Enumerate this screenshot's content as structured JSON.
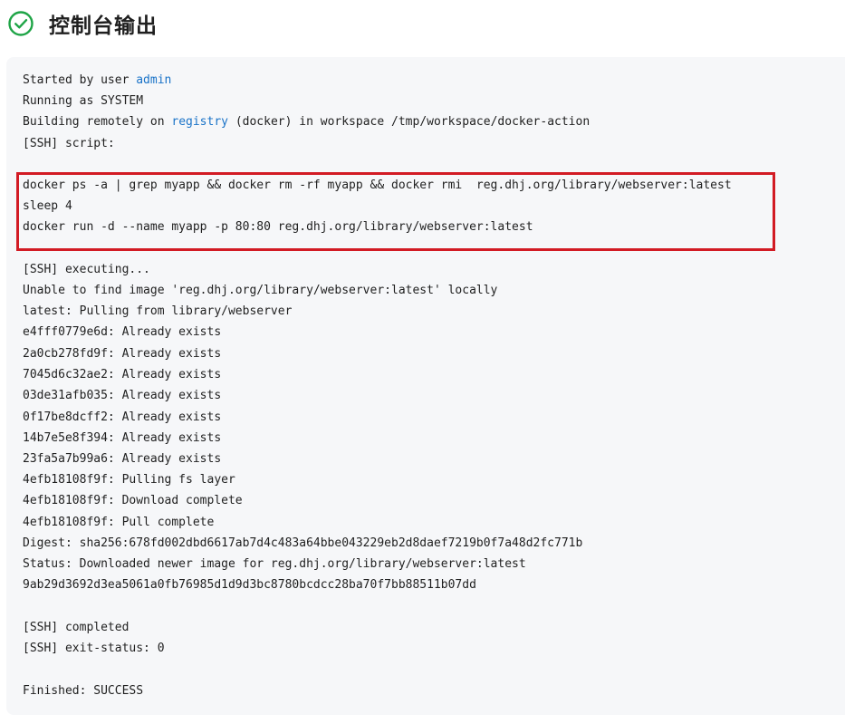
{
  "page": {
    "title": "控制台输出",
    "status_icon": "check-circle-icon",
    "status_color": "#1ea446"
  },
  "colors": {
    "console_background": "#f6f7f9",
    "link": "#1a73c8",
    "highlight_border": "#d21b24"
  },
  "console": {
    "line1": {
      "prefix": "Started by user ",
      "link": "admin"
    },
    "line2": "Running as SYSTEM",
    "line3": {
      "prefix": "Building remotely on ",
      "link": "registry",
      "suffix": " (docker) in workspace /tmp/workspace/docker-action"
    },
    "line4": "[SSH] script:",
    "script": [
      "docker ps -a | grep myapp && docker rm -rf myapp && docker rmi  reg.dhj.org/library/webserver:latest",
      "sleep 4",
      "docker run -d --name myapp -p 80:80 reg.dhj.org/library/webserver:latest"
    ],
    "output": [
      "[SSH] executing...",
      "Unable to find image 'reg.dhj.org/library/webserver:latest' locally",
      "latest: Pulling from library/webserver",
      "e4fff0779e6d: Already exists",
      "2a0cb278fd9f: Already exists",
      "7045d6c32ae2: Already exists",
      "03de31afb035: Already exists",
      "0f17be8dcff2: Already exists",
      "14b7e5e8f394: Already exists",
      "23fa5a7b99a6: Already exists",
      "4efb18108f9f: Pulling fs layer",
      "4efb18108f9f: Download complete",
      "4efb18108f9f: Pull complete",
      "Digest: sha256:678fd002dbd6617ab7d4c483a64bbe043229eb2d8daef7219b0f7a48d2fc771b",
      "Status: Downloaded newer image for reg.dhj.org/library/webserver:latest",
      "9ab29d3692d3ea5061a0fb76985d1d9d3bc8780bcdcc28ba70f7bb88511b07dd"
    ],
    "completed": "[SSH] completed",
    "exit_status": "[SSH] exit-status: 0",
    "finished": "Finished: SUCCESS"
  }
}
